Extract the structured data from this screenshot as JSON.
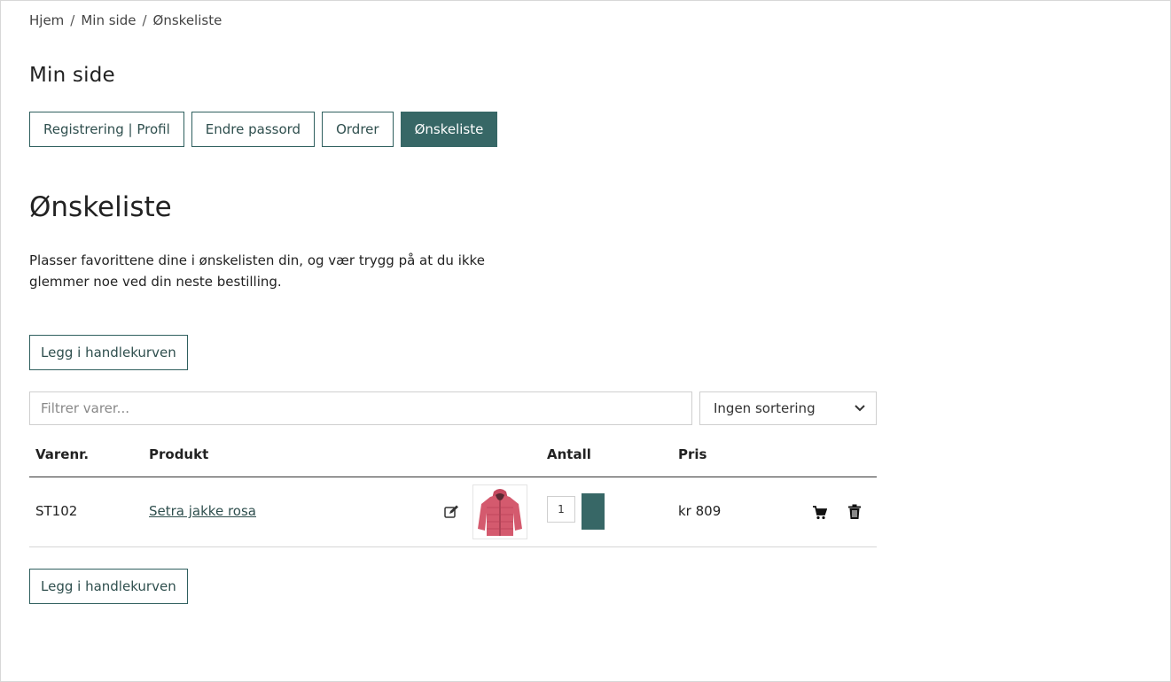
{
  "breadcrumb": {
    "items": [
      "Hjem",
      "Min side",
      "Ønskeliste"
    ],
    "separator": "/"
  },
  "page_title": "Min side",
  "tabs": [
    {
      "label": "Registrering | Profil",
      "active": false
    },
    {
      "label": "Endre passord",
      "active": false
    },
    {
      "label": "Ordrer",
      "active": false
    },
    {
      "label": "Ønskeliste",
      "active": true
    }
  ],
  "section_title": "Ønskeliste",
  "intro_text": "Plasser favorittene dine i ønskelisten din, og vær trygg på at du ikke glemmer noe ved din neste bestilling.",
  "add_to_cart_label": "Legg i handlekurven",
  "filter": {
    "placeholder": "Filtrer varer..."
  },
  "sort": {
    "selected": "Ingen sortering"
  },
  "table": {
    "headers": {
      "sku": "Varenr.",
      "product": "Produkt",
      "quantity": "Antall",
      "price": "Pris"
    },
    "rows": [
      {
        "sku": "ST102",
        "product": "Setra jakke rosa",
        "quantity": "1",
        "price": "kr 809"
      }
    ]
  },
  "icons": {
    "edit": "edit-icon",
    "cart": "cart-icon",
    "trash": "trash-icon",
    "chevron": "chevron-down-icon"
  },
  "colors": {
    "accent": "#376766",
    "text": "#222222",
    "border": "#cfcfcf",
    "jacket": "#d45a6e"
  }
}
